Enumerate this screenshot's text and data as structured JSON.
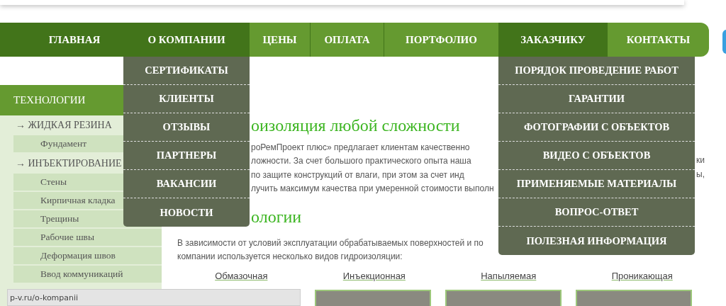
{
  "nav": [
    {
      "label": "ГЛАВНАЯ",
      "highlighted": true
    },
    {
      "label": "О КОМПАНИИ",
      "highlighted": true
    },
    {
      "label": "ЦЕНЫ",
      "highlighted": false
    },
    {
      "label": "ОПЛАТА",
      "highlighted": false
    },
    {
      "label": "ПОРТФОЛИО",
      "highlighted": false
    },
    {
      "label": "ЗАКАЗЧИКУ",
      "highlighted": true
    },
    {
      "label": "КОНТАКТЫ",
      "highlighted": false
    }
  ],
  "company_menu": [
    "СЕРТИФИКАТЫ",
    "КЛИЕНТЫ",
    "ОТЗЫВЫ",
    "ПАРТНЕРЫ",
    "ВАКАНСИИ",
    "НОВОСТИ"
  ],
  "customer_menu": [
    "ПОРЯДОК ПРОВЕДЕНИЕ РАБОТ",
    "ГАРАНТИИ",
    "ФОТОГРАФИИ С ОБЪЕКТОВ",
    "ВИДЕО С ОБЪЕКТОВ",
    "ПРИМЕНЯЕМЫЕ МАТЕРИАЛЫ",
    "ВОПРОС-ОТВЕТ",
    "ПОЛЕЗНАЯ ИНФОРМАЦИЯ"
  ],
  "sidebar": {
    "title": "ТЕХНОЛОГИИ",
    "items": [
      {
        "label": "→ ЖИДКАЯ РЕЗИНА",
        "children": [
          {
            "label": "Фундамент"
          }
        ]
      },
      {
        "label": "→ ИНЪЕКТИРОВАНИЕ",
        "children": [
          {
            "label": "Стены"
          },
          {
            "label": "Кирпичная кладка"
          },
          {
            "label": "Трещины"
          },
          {
            "label": "Рабочие швы"
          },
          {
            "label": "Деформация швов"
          },
          {
            "label": "Ввод коммуникаций"
          }
        ]
      }
    ]
  },
  "content": {
    "heading": "оизоляция любой сложности",
    "intro_lines": [
      {
        "text": "роРемПроект плюс» предлагает клиентам качественно"
      },
      {
        "text": "ложности. За счет большого практического опыта наша",
        "right": "ки"
      },
      {
        "text": "по защите конструкций от влаги, при этом за счет инд",
        "right": "ы,"
      },
      {
        "text": "лучить максимум качества при умеренной стоимости выполн"
      }
    ],
    "subheading": "ологии",
    "text_lines": [
      "В зависимости от условий эксплуатации обрабатываемых поверхностей и по",
      "компании используется несколько видов гидроизоляции:"
    ],
    "links": [
      "Обмазочная",
      "Инъекционная",
      "Напыляемая",
      "Проникающая"
    ]
  },
  "status_bar": "p-v.ru/o-kompanii"
}
